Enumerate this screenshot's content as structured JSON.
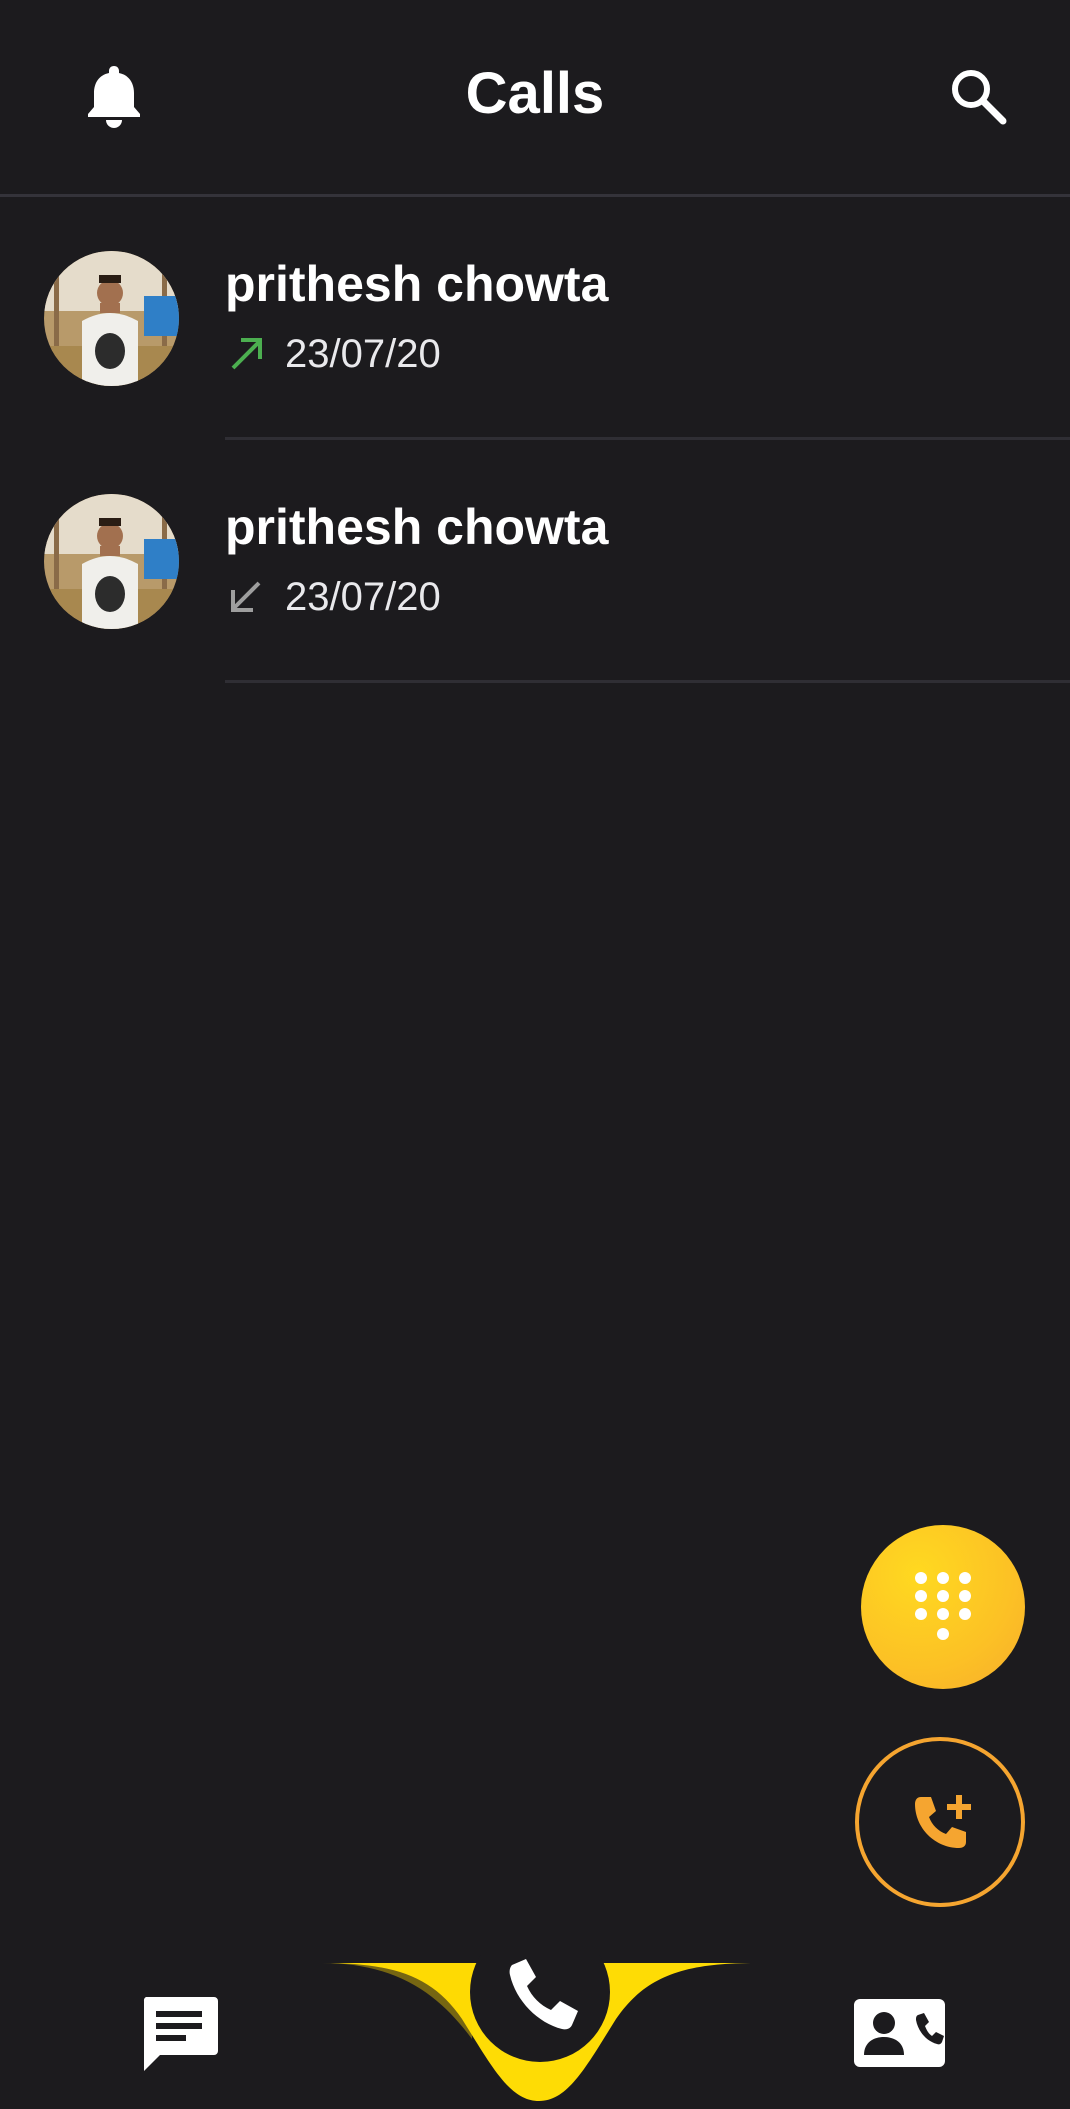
{
  "header": {
    "title": "Calls",
    "left_icon": "bell-icon",
    "right_icon": "search-icon"
  },
  "calls": [
    {
      "name": "prithesh chowta",
      "date": "23/07/20",
      "direction": "outgoing",
      "direction_icon": "outgoing-call-arrow-icon",
      "direction_color": "#4caf50"
    },
    {
      "name": "prithesh chowta",
      "date": "23/07/20",
      "direction": "incoming",
      "direction_icon": "incoming-call-arrow-icon",
      "direction_color": "#9e9e9e"
    }
  ],
  "fabs": {
    "dialpad_icon": "dialpad-icon",
    "new_call_icon": "add-call-icon"
  },
  "bottom_nav": {
    "items": [
      "chat-icon",
      "phone-icon",
      "contacts-icon"
    ],
    "active": "phone-icon"
  },
  "colors": {
    "background": "#1c1b1e",
    "accent_yellow": "#fedc05",
    "accent_orange": "#f5a530",
    "text": "#ffffff"
  }
}
